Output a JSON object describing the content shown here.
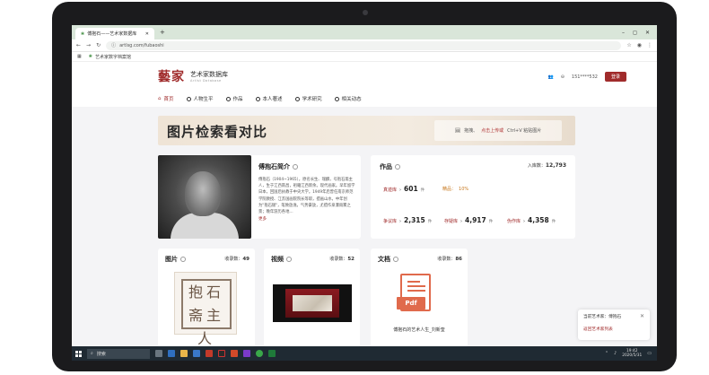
{
  "browser": {
    "tab_title": "傅抱石——艺术家数据库",
    "new_tab": "+",
    "url": "artlsg.com/fubaoshi",
    "bookmark": "艺术家数字档案馆",
    "win_min": "–",
    "win_max": "◻",
    "win_close": "✕"
  },
  "header": {
    "logo_cn": "藝家",
    "logo_title": "艺术家数据库",
    "logo_sub": "Artist Database",
    "phone": "151****532",
    "login": "登录"
  },
  "nav": [
    {
      "label": "首页"
    },
    {
      "label": "人物生平"
    },
    {
      "label": "作品"
    },
    {
      "label": "本人著述"
    },
    {
      "label": "学术研究"
    },
    {
      "label": "相关动态"
    }
  ],
  "banner": {
    "calligraphy": "图片检索看对比",
    "upload_pre": "拖拽、",
    "upload_link": "点击上传或",
    "upload_post": " Ctrl+V 粘贴图片"
  },
  "bio": {
    "title": "傅抱石简介",
    "text": "傅抱石（1904~1965），原名长生、瑞麟，号抱石斋主人，生于江西南昌，祖籍江西新余。现代画家。早年留学日本，回国后执教于中央大学。1949年后曾任南京师范学院教授、江苏国画院院长等职，擅画山水，中年创为\"抱石皴\"，笔致放逸，气势豪放，尤擅作泉瀑雨雾之景；晚年游历各地…",
    "more": "更多"
  },
  "works": {
    "title": "作品",
    "total_label": "入库数：",
    "total": "12,793",
    "stats": [
      {
        "label": "真迹库",
        "value": "601",
        "unit": "件"
      },
      {
        "label": "争议库",
        "value": "2,315",
        "unit": "件"
      },
      {
        "label": "存疑库",
        "value": "4,917",
        "unit": "件"
      },
      {
        "label": "伪作库",
        "value": "4,358",
        "unit": "件"
      }
    ],
    "fine_label": "精品：",
    "fine_value": "10%"
  },
  "pictures": {
    "title": "图片",
    "count_label": "收录数：",
    "count": "49",
    "seal_text": "抱石斋主人"
  },
  "videos": {
    "title": "视频",
    "count_label": "收录数：",
    "count": "52"
  },
  "documents": {
    "title": "文档",
    "count_label": "收录数：",
    "count": "86",
    "pdf_tag": "Pdf",
    "doc_name": "傅抱石的艺术人生_刘新奎"
  },
  "toast": {
    "current_label": "当前艺术家：",
    "current_name": "傅抱石",
    "link": "返回艺术家列表",
    "close": "✕"
  },
  "taskbar": {
    "search": "搜索",
    "time": "19:42",
    "date": "2020/5/31"
  },
  "colors": {
    "brand": "#a02b2b",
    "bg": "#f4f4f6",
    "taskbar": "#1f2a33",
    "pdf": "#e06a4c"
  }
}
